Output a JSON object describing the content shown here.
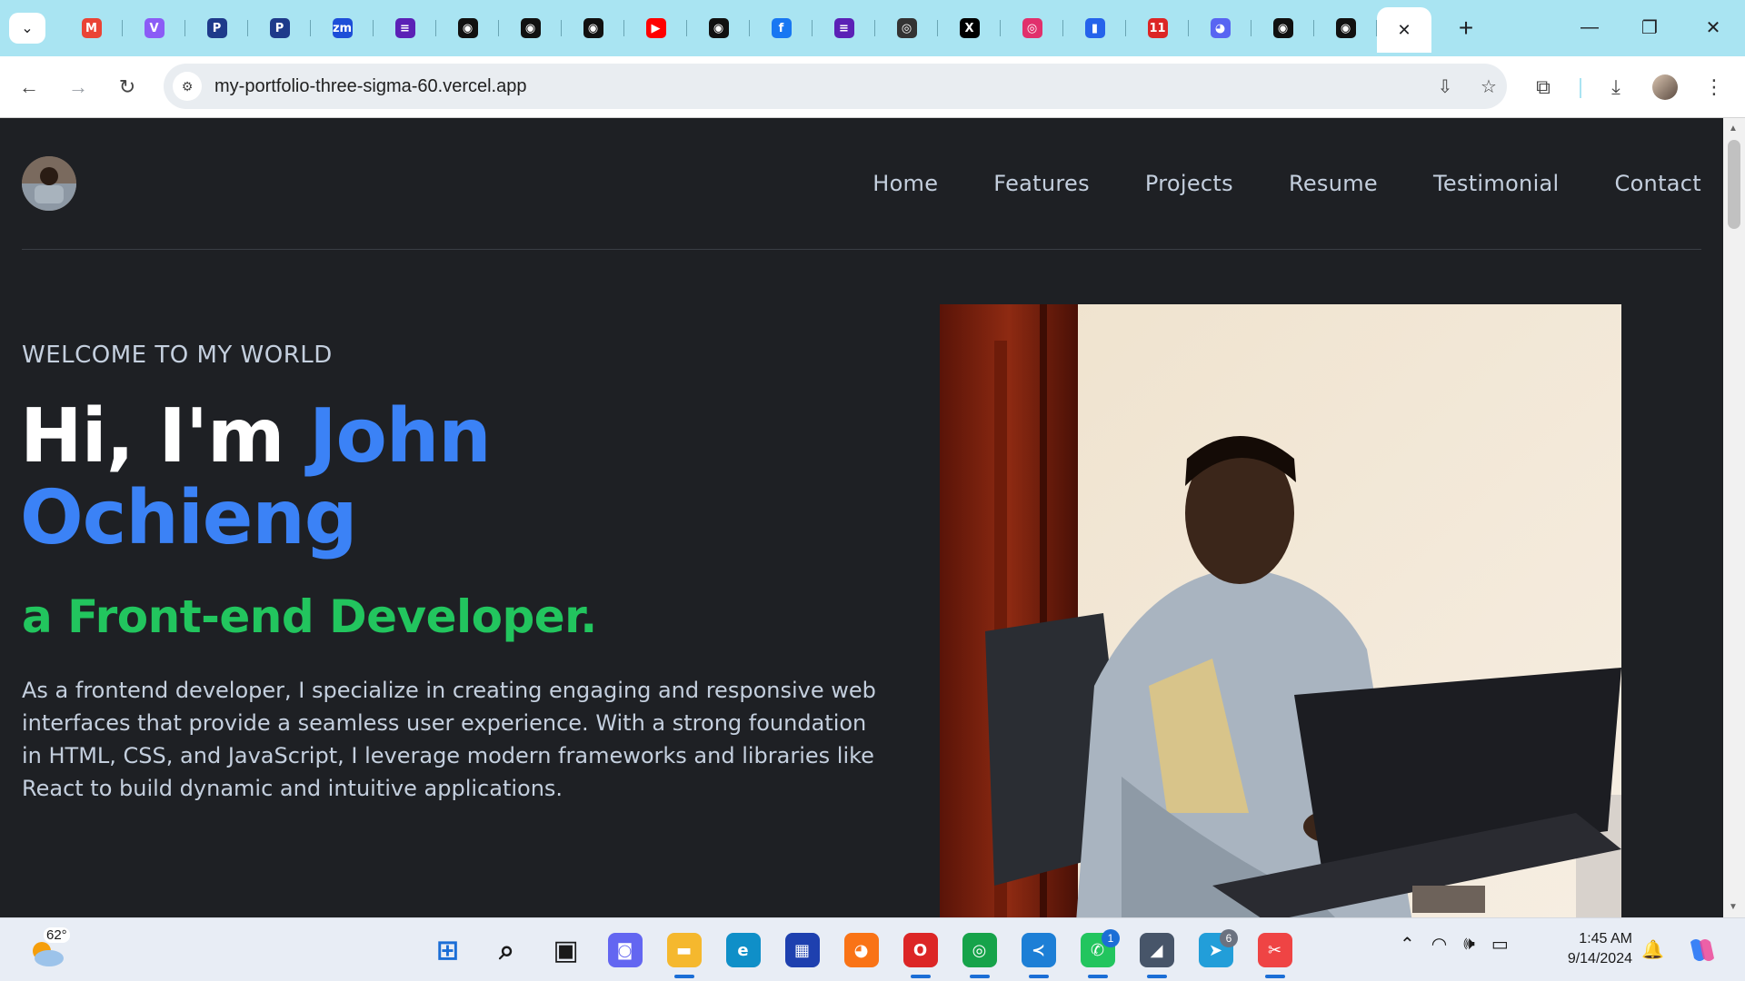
{
  "browser": {
    "tabs": [
      {
        "icon": "gmail-icon",
        "glyph": "M",
        "color": "#ea4335"
      },
      {
        "icon": "vite-icon",
        "glyph": "V",
        "color": "#8b5cf6"
      },
      {
        "icon": "pe-icon",
        "glyph": "P",
        "color": "#1e3a8a"
      },
      {
        "icon": "pe-icon",
        "glyph": "P",
        "color": "#1e3a8a"
      },
      {
        "icon": "zoom-icon",
        "glyph": "zm",
        "color": "#1d4ed8"
      },
      {
        "icon": "forms-icon",
        "glyph": "≡",
        "color": "#5b21b6"
      },
      {
        "icon": "github-icon",
        "glyph": "◉",
        "color": "#111111"
      },
      {
        "icon": "github-icon",
        "glyph": "◉",
        "color": "#111111"
      },
      {
        "icon": "github-icon",
        "glyph": "◉",
        "color": "#111111"
      },
      {
        "icon": "youtube-icon",
        "glyph": "▶",
        "color": "#ff0000"
      },
      {
        "icon": "github-icon",
        "glyph": "◉",
        "color": "#111111"
      },
      {
        "icon": "facebook-icon",
        "glyph": "f",
        "color": "#1877f2"
      },
      {
        "icon": "forms-icon",
        "glyph": "≡",
        "color": "#5b21b6"
      },
      {
        "icon": "chrome-icon",
        "glyph": "◎",
        "color": "#333333"
      },
      {
        "icon": "x-icon",
        "glyph": "X",
        "color": "#000000"
      },
      {
        "icon": "instagram-icon",
        "glyph": "◎",
        "color": "#e1306c"
      },
      {
        "icon": "app-icon",
        "glyph": "▮",
        "color": "#2563eb"
      },
      {
        "icon": "calendar-icon",
        "glyph": "11",
        "color": "#dc2626"
      },
      {
        "icon": "discord-icon",
        "glyph": "◕",
        "color": "#5865f2"
      },
      {
        "icon": "github-icon",
        "glyph": "◉",
        "color": "#111111"
      },
      {
        "icon": "github-icon",
        "glyph": "◉",
        "color": "#111111"
      }
    ],
    "active_tab_close": "✕",
    "new_tab": "+",
    "url": "my-portfolio-three-sigma-60.vercel.app",
    "window_controls": {
      "minimize": "—",
      "restore": "❐",
      "close": "✕"
    }
  },
  "nav": {
    "items": [
      "Home",
      "Features",
      "Projects",
      "Resume",
      "Testimonial",
      "Contact"
    ]
  },
  "hero": {
    "welcome": "WELCOME TO MY WORLD",
    "greeting": "Hi, I'm ",
    "name": "John Ochieng",
    "role": "a Front-end Developer.",
    "intro": "As a frontend developer, I specialize in creating engaging and responsive web interfaces that provide a seamless user experience. With a strong foundation in HTML, CSS, and JavaScript, I leverage modern frameworks and libraries like React to build dynamic and intuitive applications."
  },
  "taskbar": {
    "temperature": "62°",
    "apps": [
      {
        "name": "start-icon",
        "glyph": "⊞",
        "color": "#1b6ed6",
        "bg": "transparent",
        "active": false
      },
      {
        "name": "search-icon",
        "glyph": "⌕",
        "color": "#1a1a1a",
        "bg": "transparent",
        "active": false
      },
      {
        "name": "task-view-icon",
        "glyph": "▣",
        "color": "#1a1a1a",
        "bg": "transparent",
        "active": false
      },
      {
        "name": "meet-icon",
        "glyph": "◙",
        "color": "#ffffff",
        "bg": "#6366f1",
        "active": false
      },
      {
        "name": "file-explorer-icon",
        "glyph": "▬",
        "color": "#ffffff",
        "bg": "#f5b82e",
        "active": true
      },
      {
        "name": "edge-icon",
        "glyph": "e",
        "color": "#ffffff",
        "bg": "#0f8fc8",
        "active": false
      },
      {
        "name": "store-icon",
        "glyph": "▦",
        "color": "#ffffff",
        "bg": "#1e40af",
        "active": false
      },
      {
        "name": "firefox-icon",
        "glyph": "◕",
        "color": "#ffffff",
        "bg": "#f97316",
        "active": false
      },
      {
        "name": "opera-icon",
        "glyph": "O",
        "color": "#ffffff",
        "bg": "#dc2626",
        "active": true
      },
      {
        "name": "chrome-icon",
        "glyph": "◎",
        "color": "#ffffff",
        "bg": "#16a34a",
        "active": true
      },
      {
        "name": "vscode-icon",
        "glyph": "≺",
        "color": "#ffffff",
        "bg": "#1d7fd6",
        "active": true
      },
      {
        "name": "whatsapp-icon",
        "glyph": "✆",
        "color": "#ffffff",
        "bg": "#22c55e",
        "active": true,
        "badge": "1"
      },
      {
        "name": "app-icon",
        "glyph": "◢",
        "color": "#ffffff",
        "bg": "#475569",
        "active": true
      },
      {
        "name": "telegram-icon",
        "glyph": "➤",
        "color": "#ffffff",
        "bg": "#229ed9",
        "active": false,
        "badge": "6"
      },
      {
        "name": "snipping-tool-icon",
        "glyph": "✂",
        "color": "#ffffff",
        "bg": "#ef4444",
        "active": true
      }
    ],
    "time": "1:45 AM",
    "date": "9/14/2024"
  }
}
